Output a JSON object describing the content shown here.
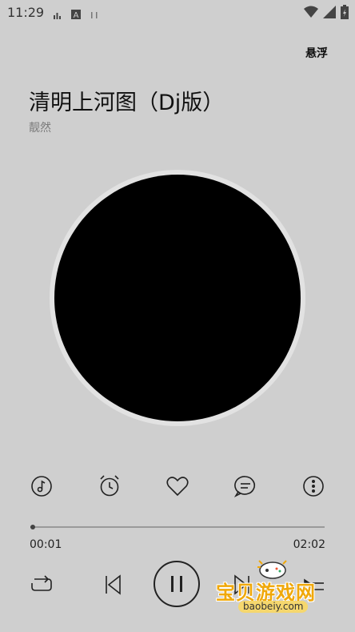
{
  "status_bar": {
    "time": "11:29",
    "icons": [
      "signal-bars-icon",
      "keyboard-a-icon",
      "sim-icon",
      "wifi-icon",
      "cell-signal-icon",
      "battery-icon"
    ]
  },
  "header": {
    "float_label": "悬浮"
  },
  "song": {
    "title": "清明上河图（Dj版）",
    "artist": "靓然"
  },
  "actions": [
    "music-note-icon",
    "alarm-clock-icon",
    "heart-icon",
    "comment-icon",
    "more-vertical-icon"
  ],
  "progress": {
    "current": "00:01",
    "total": "02:02",
    "fraction": 0.008
  },
  "controls": [
    "repeat-icon",
    "previous-icon",
    "pause-icon",
    "next-icon",
    "playlist-icon"
  ],
  "watermark": {
    "text": "宝贝游戏网",
    "url": "baobeiy.com"
  },
  "colors": {
    "background": "#cfcfcf",
    "disc": "#000000",
    "watermark": "#f0a80a"
  }
}
